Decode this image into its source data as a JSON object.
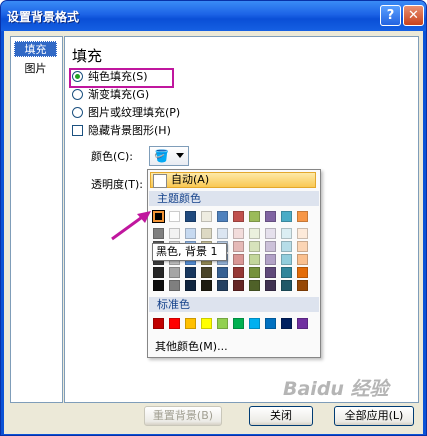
{
  "window": {
    "title": "设置背景格式",
    "help_label": "?",
    "close_label": "✕"
  },
  "nav": {
    "items": [
      "填充",
      "图片"
    ]
  },
  "fill": {
    "title": "填充",
    "options": [
      "纯色填充(S)",
      "渐变填充(G)",
      "图片或纹理填充(P)"
    ],
    "hide_bg": "隐藏背景图形(H)",
    "color_label": "颜色(C):",
    "transparency_label": "透明度(T):"
  },
  "palette": {
    "auto_label": "自动(A)",
    "theme_header": "主题颜色",
    "standard_header": "标准色",
    "more_colors": "其他颜色(M)...",
    "tooltip": "黑色, 背景 1",
    "theme_top": [
      "#000000",
      "#ffffff",
      "#1f497d",
      "#eeece1",
      "#4f81bd",
      "#c0504d",
      "#9bbb59",
      "#8064a2",
      "#4bacc6",
      "#f79646"
    ],
    "theme_shades": [
      [
        "#7f7f7f",
        "#595959",
        "#3f3f3f",
        "#262626",
        "#0c0c0c"
      ],
      [
        "#f2f2f2",
        "#d8d8d8",
        "#bfbfbf",
        "#a5a5a5",
        "#7f7f7f"
      ],
      [
        "#c6d9f0",
        "#8db3e2",
        "#548dd4",
        "#17365d",
        "#0f243e"
      ],
      [
        "#ddd9c3",
        "#c4bd97",
        "#938953",
        "#494429",
        "#1d1b10"
      ],
      [
        "#dbe5f1",
        "#b8cce4",
        "#95b3d7",
        "#366092",
        "#244061"
      ],
      [
        "#f2dcdb",
        "#e5b9b7",
        "#d99694",
        "#953734",
        "#632423"
      ],
      [
        "#ebf1dd",
        "#d7e3bc",
        "#c3d69b",
        "#76923c",
        "#4f6128"
      ],
      [
        "#e5e0ec",
        "#ccc1d9",
        "#b2a2c7",
        "#5f497a",
        "#3f3151"
      ],
      [
        "#dbeef3",
        "#b7dde8",
        "#92cddc",
        "#31859b",
        "#205867"
      ],
      [
        "#fdeada",
        "#fbd5b5",
        "#fac08f",
        "#e36c09",
        "#974806"
      ]
    ],
    "standard": [
      "#c00000",
      "#ff0000",
      "#ffc000",
      "#ffff00",
      "#92d050",
      "#00b050",
      "#00b0f0",
      "#0070c0",
      "#002060",
      "#7030a0"
    ],
    "selected_color": "#000000"
  },
  "footer": {
    "reset": "重置背景(B)",
    "close": "关闭",
    "apply_all": "全部应用(L)"
  },
  "watermark": "Baidu 经验",
  "accent": "#c0169e"
}
